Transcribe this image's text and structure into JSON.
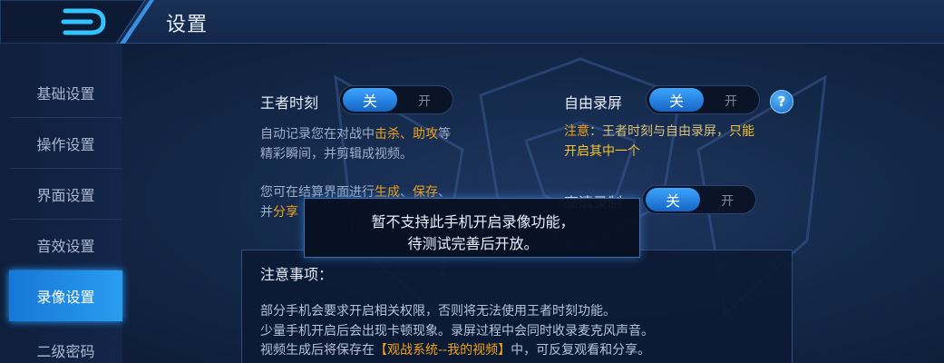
{
  "header": {
    "title": "设置"
  },
  "sidebar": {
    "items": [
      {
        "label": "基础设置",
        "active": false
      },
      {
        "label": "操作设置",
        "active": false
      },
      {
        "label": "界面设置",
        "active": false
      },
      {
        "label": "音效设置",
        "active": false
      },
      {
        "label": "录像设置",
        "active": true
      },
      {
        "label": "二级密码",
        "active": false
      }
    ]
  },
  "settings": {
    "wangzhe": {
      "label": "王者时刻",
      "on_label": "关",
      "off_label": "开",
      "desc1_a": "自动记录您在对战中",
      "desc1_b": "击杀",
      "desc1_c": "、",
      "desc1_d": "助攻",
      "desc1_e": "等",
      "desc2": "精彩瞬间，并剪辑成视频。",
      "desc3_a": "您可在结算界面进行",
      "desc3_b": "生成",
      "desc3_c": "、",
      "desc3_d": "保存",
      "desc3_e": "、",
      "desc4_a": "并",
      "desc4_b": "分享"
    },
    "ziyou": {
      "label": "自由录屏",
      "on_label": "关",
      "off_label": "开",
      "help": "?",
      "note_a": "注意",
      "note_b": "：王者时刻与自由录屏，",
      "note_c": "只能",
      "note_d": "开启其中一个"
    },
    "gaoqing": {
      "label": "高清录制",
      "on_label": "关",
      "off_label": "开"
    }
  },
  "notice": {
    "title": "注意事项：",
    "line1": "部分手机会要求开启相关权限，否则将无法使用王者时刻功能。",
    "line2": "少量手机开启后会出现卡顿现象。录屏过程中会同时收录麦克风声音。",
    "line3_a": "视频生成后将保存在",
    "line3_b": "【观战系统--我的视频】",
    "line3_c": "中，可反复观看和分享。"
  },
  "toast": {
    "line1": "暂不支持此手机开启录像功能，",
    "line2": "待测试完善后开放。"
  },
  "colors": {
    "accent": "#2a9df0",
    "highlight": "#f0a21a",
    "yellow": "#f5c428"
  }
}
